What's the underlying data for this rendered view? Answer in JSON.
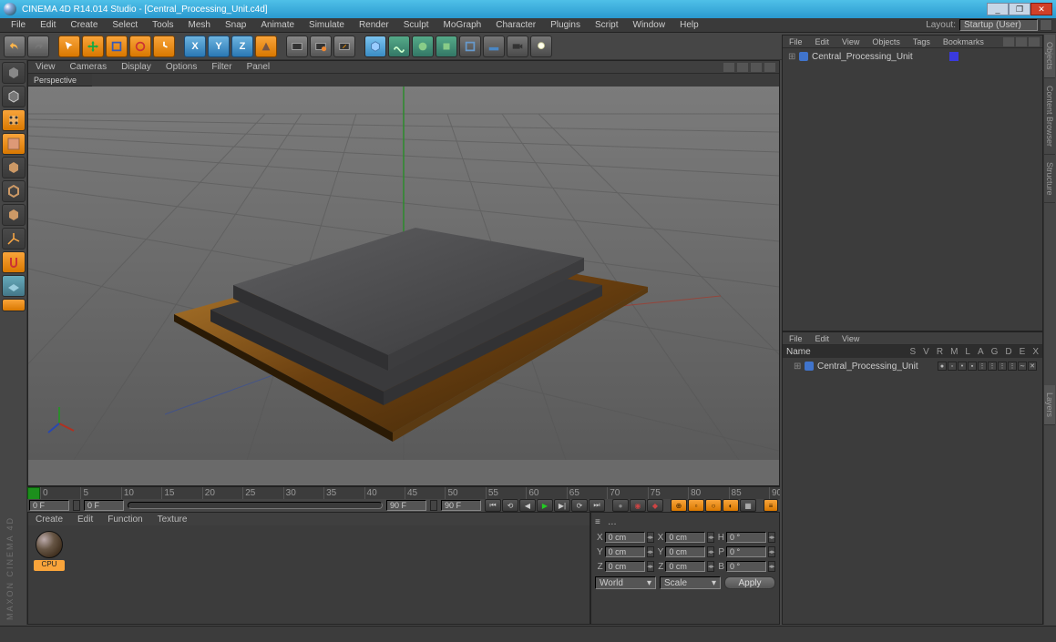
{
  "title": "CINEMA 4D R14.014 Studio - [Central_Processing_Unit.c4d]",
  "main_menu": [
    "File",
    "Edit",
    "Create",
    "Select",
    "Tools",
    "Mesh",
    "Snap",
    "Animate",
    "Simulate",
    "Render",
    "Sculpt",
    "MoGraph",
    "Character",
    "Plugins",
    "Script",
    "Window",
    "Help"
  ],
  "layout_label": "Layout:",
  "layout_value": "Startup (User)",
  "viewport_menu": [
    "View",
    "Cameras",
    "Display",
    "Options",
    "Filter",
    "Panel"
  ],
  "viewport_tab": "Perspective",
  "timeline": {
    "start_frame": "0 F",
    "end_frame": "90 F",
    "cur_start": "0 F",
    "cur_end": "90 F",
    "ticks": [
      0,
      5,
      10,
      15,
      20,
      25,
      30,
      35,
      40,
      45,
      50,
      55,
      60,
      65,
      70,
      75,
      80,
      85,
      90
    ]
  },
  "material_menu": [
    "Create",
    "Edit",
    "Function",
    "Texture"
  ],
  "material_name": "CPU",
  "coord": {
    "menu": [
      "≡",
      "…"
    ],
    "rows": [
      {
        "a": "X",
        "v1": "0 cm",
        "b": "X",
        "v2": "0 cm",
        "c": "H",
        "v3": "0 °"
      },
      {
        "a": "Y",
        "v1": "0 cm",
        "b": "Y",
        "v2": "0 cm",
        "c": "P",
        "v3": "0 °"
      },
      {
        "a": "Z",
        "v1": "0 cm",
        "b": "Z",
        "v2": "0 cm",
        "c": "B",
        "v3": "0 °"
      }
    ],
    "space": "World",
    "mode": "Scale",
    "apply": "Apply"
  },
  "obj_menu": [
    "File",
    "Edit",
    "View",
    "Objects",
    "Tags",
    "Bookmarks"
  ],
  "obj_item": "Central_Processing_Unit",
  "attr_menu": [
    "File",
    "Edit",
    "View"
  ],
  "attr_name_hdr": "Name",
  "attr_cols": [
    "S",
    "V",
    "R",
    "M",
    "L",
    "A",
    "G",
    "D",
    "E",
    "X"
  ],
  "attr_item": "Central_Processing_Unit",
  "right_tabs": [
    "Objects",
    "Content Browser",
    "Structure",
    "Layers"
  ],
  "brand": "MAXON\nCINEMA 4D"
}
